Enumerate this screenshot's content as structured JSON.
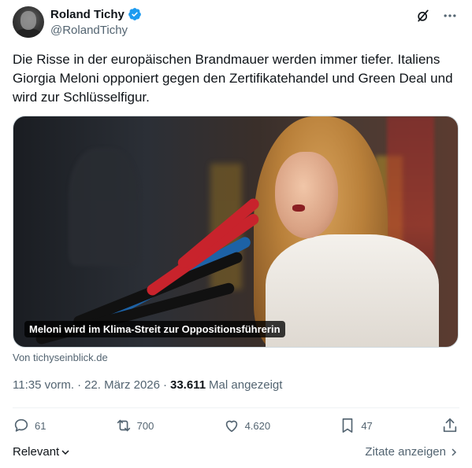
{
  "author": {
    "display_name": "Roland Tichy",
    "handle": "@RolandTichy",
    "verified": true
  },
  "tweet": {
    "text": "Die Risse in der europäischen Brandmauer werden immer tiefer. Italiens Giorgia Meloni opponiert gegen den Zertifikatehandel und Green Deal und wird zur Schlüsselfigur.",
    "media_caption": "Meloni wird im Klima-Streit zur Oppositionsführerin",
    "source": "Von tichyseinblick.de",
    "time": "11:35 vorm.",
    "date": "22. März 2026",
    "separator": "·",
    "views_count": "33.611",
    "views_label": "Mal angezeigt"
  },
  "actions": {
    "replies": "61",
    "reposts": "700",
    "likes": "4.620",
    "bookmarks": "47"
  },
  "footer": {
    "sort_label": "Relevant",
    "quotes_label": "Zitate anzeigen"
  },
  "icons": [
    "grok-icon",
    "more-icon",
    "verified-icon",
    "reply-icon",
    "repost-icon",
    "like-icon",
    "bookmark-icon",
    "share-icon",
    "chevron-down-icon",
    "chevron-right-icon"
  ],
  "colors": {
    "verified": "#1d9bf0",
    "text_primary": "#0f1419",
    "text_secondary": "#536471"
  }
}
